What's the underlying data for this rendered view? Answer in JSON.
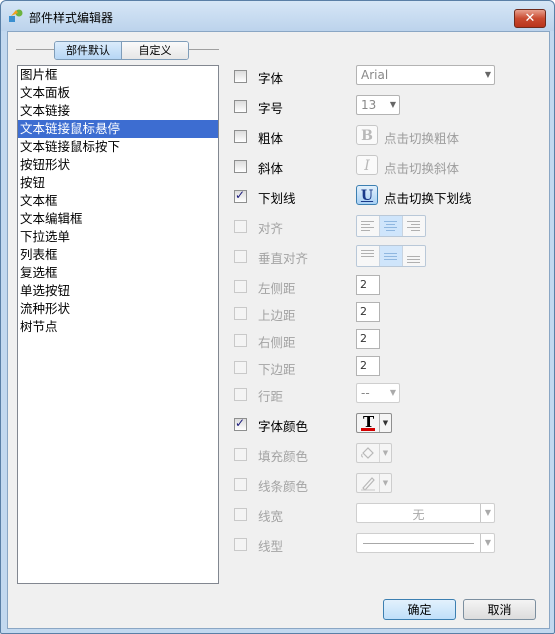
{
  "window": {
    "title": "部件样式编辑器",
    "close_label": "✕"
  },
  "tabs": [
    {
      "label": "部件默认",
      "active": true
    },
    {
      "label": "自定义",
      "active": false
    }
  ],
  "list": {
    "items": [
      "图片框",
      "文本面板",
      "文本链接",
      "文本链接鼠标悬停",
      "文本链接鼠标按下",
      "按钮形状",
      "按钮",
      "文本框",
      "文本编辑框",
      "下拉选单",
      "列表框",
      "复选框",
      "单选按钮",
      "流种形状",
      "树节点"
    ],
    "selected": "文本链接鼠标悬停"
  },
  "props": {
    "font": {
      "label": "字体",
      "value": "Arial",
      "checked": false
    },
    "size": {
      "label": "字号",
      "value": "13",
      "checked": false
    },
    "bold": {
      "label": "粗体",
      "button": "B",
      "hint": "点击切换粗体",
      "checked": false
    },
    "italic": {
      "label": "斜体",
      "button": "I",
      "hint": "点击切换斜体",
      "checked": false
    },
    "underline": {
      "label": "下划线",
      "button": "U",
      "hint": "点击切换下划线",
      "checked": true
    },
    "align": {
      "label": "对齐",
      "checked": false
    },
    "valign": {
      "label": "垂直对齐",
      "checked": false
    },
    "padding_left": {
      "label": "左侧距",
      "value": "2",
      "checked": false
    },
    "padding_top": {
      "label": "上边距",
      "value": "2",
      "checked": false
    },
    "padding_right": {
      "label": "右侧距",
      "value": "2",
      "checked": false
    },
    "padding_bottom": {
      "label": "下边距",
      "value": "2",
      "checked": false
    },
    "line_spacing": {
      "label": "行距",
      "value": "--",
      "checked": false
    },
    "font_color": {
      "label": "字体颜色",
      "glyph": "T",
      "checked": true,
      "color": "#d40000"
    },
    "fill_color": {
      "label": "填充颜色",
      "checked": false
    },
    "line_color": {
      "label": "线条颜色",
      "checked": false
    },
    "line_width": {
      "label": "线宽",
      "value": "无",
      "checked": false
    },
    "line_type": {
      "label": "线型",
      "checked": false
    }
  },
  "buttons": {
    "ok": "确定",
    "cancel": "取消"
  }
}
